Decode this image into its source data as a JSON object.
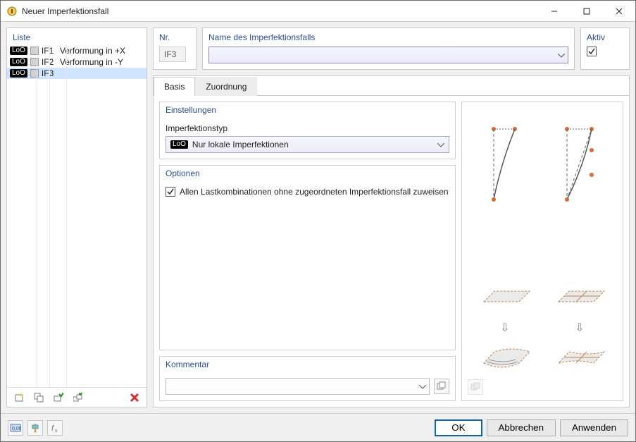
{
  "title": "Neuer Imperfektionsfall",
  "list": {
    "header": "Liste",
    "items": [
      {
        "badge": "LoO",
        "id": "IF1",
        "name": "Verformung in +X",
        "selected": false
      },
      {
        "badge": "LoO",
        "id": "IF2",
        "name": "Verformung in -Y",
        "selected": false
      },
      {
        "badge": "LoO",
        "id": "IF3",
        "name": "",
        "selected": true
      }
    ]
  },
  "nr": {
    "label": "Nr.",
    "value": "IF3"
  },
  "name": {
    "label": "Name des Imperfektionsfalls",
    "value": ""
  },
  "aktiv": {
    "label": "Aktiv",
    "checked": true
  },
  "tabs": {
    "basis": "Basis",
    "zuordnung": "Zuordnung"
  },
  "settings": {
    "header": "Einstellungen",
    "typeLabel": "Imperfektionstyp",
    "typeBadge": "LoO",
    "typeValue": "Nur lokale Imperfektionen"
  },
  "options": {
    "header": "Optionen",
    "assignAll": "Allen Lastkombinationen ohne zugeordneten Imperfektionsfall zuweisen",
    "assignAllChecked": true
  },
  "comment": {
    "header": "Kommentar",
    "value": ""
  },
  "buttons": {
    "ok": "OK",
    "cancel": "Abbrechen",
    "apply": "Anwenden"
  }
}
